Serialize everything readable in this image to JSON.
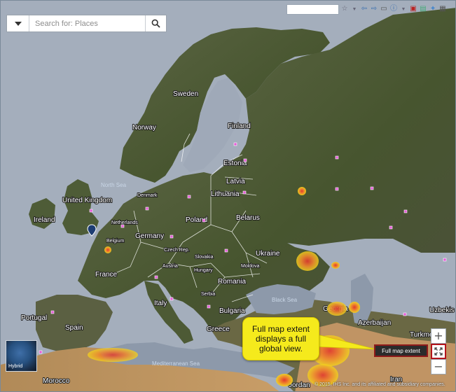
{
  "search": {
    "placeholder": "Search for: Places",
    "dropdown_icon": "caret-down-icon",
    "go_icon": "search-icon"
  },
  "map": {
    "countries": [
      "Sweden",
      "Finland",
      "Norway",
      "Estonia",
      "Latvia",
      "Lithuania",
      "United Kingdom",
      "Ireland",
      "Denmark",
      "Netherlands",
      "Belgium",
      "Germany",
      "Poland",
      "Belarus",
      "Czech Rep.",
      "Slovakia",
      "Austria",
      "Hungary",
      "Moldova",
      "Ukraine",
      "France",
      "Romania",
      "Serbia",
      "Italy",
      "Bulgaria",
      "Portugal",
      "Spain",
      "Greece",
      "Georgia",
      "Azerbaijan",
      "Turkmenis",
      "Uzbekis",
      "Iran",
      "Jordan",
      "Morocco"
    ],
    "seas": [
      "North Sea",
      "Black Sea",
      "Mediterranean Sea"
    ],
    "colors": {
      "land": "#4d5a35",
      "sea": "#a9b3c0",
      "hotspot_red": "#e23a2e",
      "hotspot_yellow": "#f3d21c",
      "marker_pink": "#e35bd6"
    }
  },
  "controls": {
    "zoom_in": "+",
    "zoom_out": "−",
    "full_extent_icon": "expand-icon",
    "full_extent_tooltip": "Full map extent"
  },
  "basemap": {
    "label": "Hybrid"
  },
  "callout": {
    "text": "Full map extent displays a full global view."
  },
  "copyright": "© 2015, IHS Inc. and its affiliated and subsidiary companies."
}
